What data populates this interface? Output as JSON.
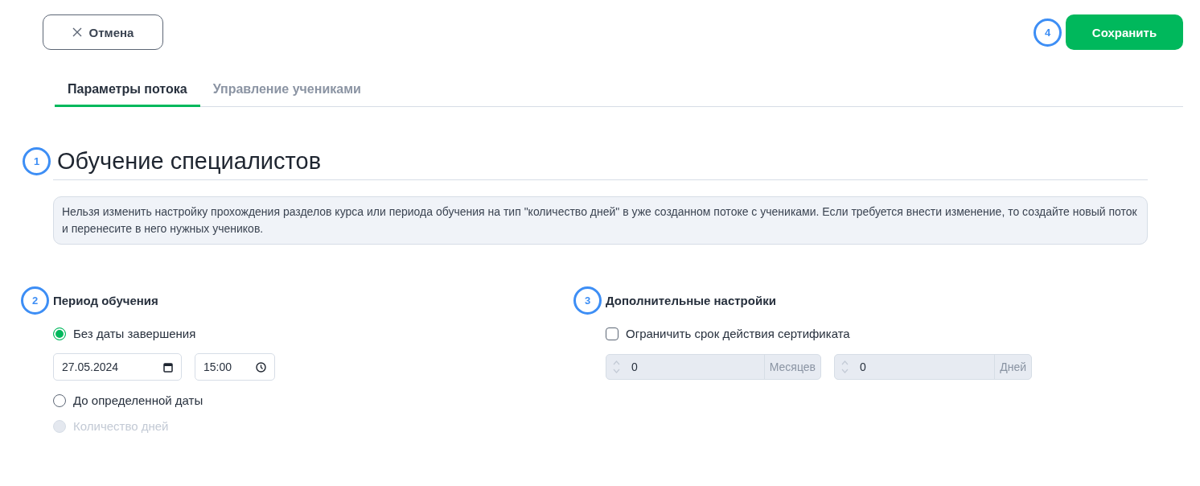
{
  "toolbar": {
    "cancel_button": "Отмена",
    "save_step": "4",
    "save_button": "Сохранить"
  },
  "tabs": [
    {
      "label": "Параметры потока",
      "selected": true
    },
    {
      "label": "Управление учениками",
      "selected": false
    }
  ],
  "title": {
    "step": "1",
    "text": "Обучение специалистов"
  },
  "notice": "Нельзя изменить настройку прохождения разделов курса или периода обучения на тип \"количество дней\" в уже созданном потоке с учениками. Если требуется внести изменение, то создайте новый поток и перенесите в него нужных учеников.",
  "period": {
    "step": "2",
    "heading": "Период обучения",
    "options": [
      {
        "label": "Без даты завершения",
        "selected": true,
        "disabled": false,
        "date": "27.05.2024",
        "time": "15:00"
      },
      {
        "label": "До определенной даты",
        "selected": false,
        "disabled": false
      },
      {
        "label": "Количество дней",
        "selected": false,
        "disabled": true
      }
    ]
  },
  "extra": {
    "step": "3",
    "heading": "Дополнительные настройки",
    "certificate_limit": {
      "label": "Ограничить срок действия сертификата",
      "checked": false
    },
    "durations": [
      {
        "value": "0",
        "unit": "Месяцев",
        "disabled": true
      },
      {
        "value": "0",
        "unit": "Дней",
        "disabled": true
      }
    ]
  }
}
